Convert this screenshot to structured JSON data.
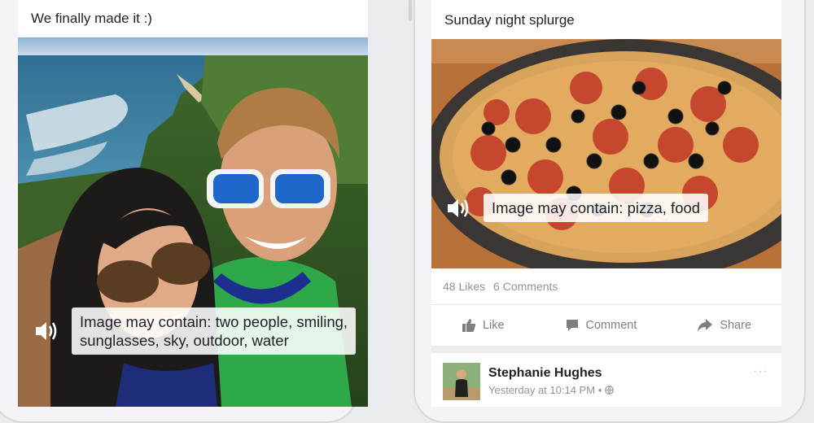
{
  "left_post": {
    "caption": "We finally made it :)",
    "alt_text_line1": "Image may contain: two people, smiling,",
    "alt_text_line2": "sunglasses, sky, outdoor, water"
  },
  "right_post": {
    "caption": "Sunday night splurge",
    "alt_text": "Image may contain: pizza, food",
    "likes": "48 Likes",
    "comments": "6 Comments",
    "actions": {
      "like": "Like",
      "comment": "Comment",
      "share": "Share"
    }
  },
  "next_post": {
    "author": "Stephanie Hughes",
    "timestamp": "Yesterday at 10:14 PM",
    "separator": "•",
    "more": "···"
  },
  "icons": {
    "speaker": "speaker-icon",
    "like": "thumbs-up-icon",
    "comment": "comment-icon",
    "share": "share-icon",
    "privacy": "globe-icon",
    "more": "more-options-icon"
  },
  "colors": {
    "feed_background": "#e9ebee",
    "text_primary": "#1d2129",
    "text_secondary": "#90949c",
    "action_text": "#7f7f7f"
  }
}
